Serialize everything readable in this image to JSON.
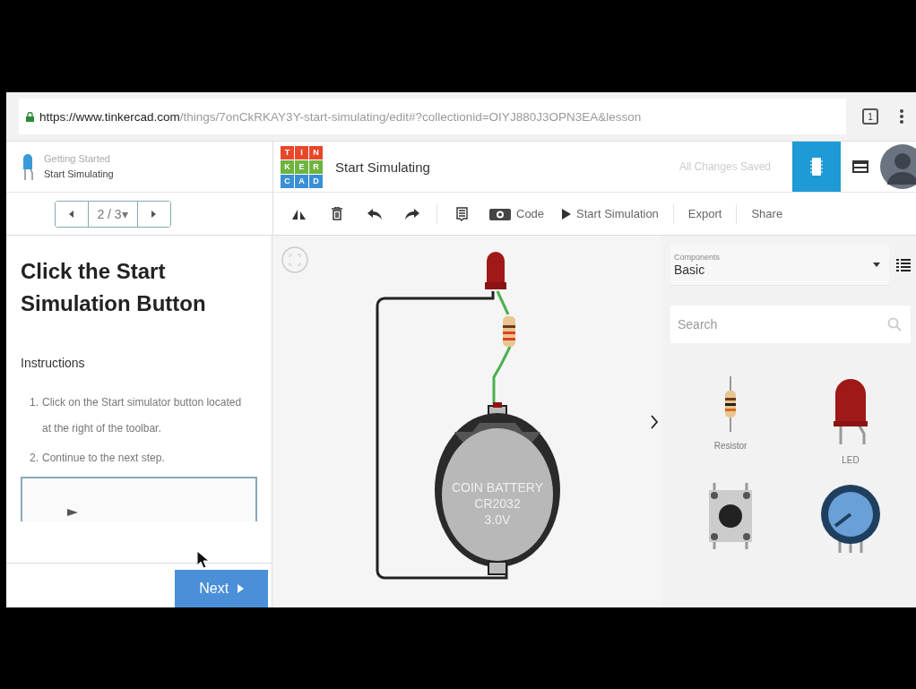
{
  "browser": {
    "url_host": "https://www.tinkercad.com",
    "url_path": "/things/7onCkRKAY3Y-start-simulating/edit#?collectionid=OIYJ880J3OPN3EA&lesson",
    "tab_count": "1"
  },
  "lesson_header": {
    "category": "Getting Started",
    "title": "Start Simulating",
    "pager": "2 / 3▾"
  },
  "logo": {
    "letters": [
      {
        "char": "T",
        "color": "#e8472b"
      },
      {
        "char": "I",
        "color": "#e8472b"
      },
      {
        "char": "N",
        "color": "#e8472b"
      },
      {
        "char": "K",
        "color": "#6eb43f"
      },
      {
        "char": "E",
        "color": "#6eb43f"
      },
      {
        "char": "R",
        "color": "#6eb43f"
      },
      {
        "char": "C",
        "color": "#3b8fd6"
      },
      {
        "char": "A",
        "color": "#3b8fd6"
      },
      {
        "char": "D",
        "color": "#3b8fd6"
      }
    ]
  },
  "design": {
    "title": "Start Simulating",
    "status": "All Changes Saved"
  },
  "toolbar": [
    {
      "kind": "rotate"
    },
    {
      "kind": "delete"
    },
    {
      "kind": "undo"
    },
    {
      "kind": "redo"
    },
    {
      "kind": "notes"
    },
    {
      "kind": "code",
      "label": "Code"
    },
    {
      "kind": "simulate",
      "label": "Start Simulation"
    },
    {
      "kind": "text",
      "label": "Export"
    },
    {
      "kind": "text",
      "label": "Share"
    }
  ],
  "lesson": {
    "heading": "Click the Start Simulation Button",
    "subheading": "Instructions",
    "steps": [
      {
        "number": "1.",
        "text": "Click on the Start simulator button located at the right of the toolbar."
      },
      {
        "number": "2.",
        "text": "Continue to the next step."
      }
    ],
    "next": "Next"
  },
  "circuit": {
    "battery_lines": [
      "COIN BATTERY",
      "CR2032",
      "3.0V"
    ]
  },
  "components": {
    "label": "Components",
    "category": "Basic",
    "search_placeholder": "Search",
    "items": [
      {
        "kind": "resistor",
        "label": "Resistor"
      },
      {
        "kind": "led",
        "label": "LED"
      },
      {
        "kind": "pushbutton"
      },
      {
        "kind": "potentiometer"
      }
    ]
  }
}
